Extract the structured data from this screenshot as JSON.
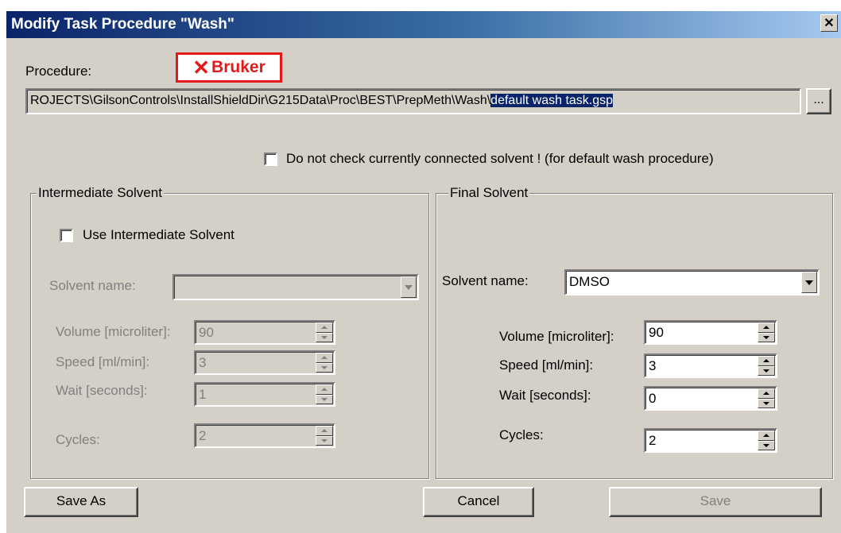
{
  "window": {
    "title": "Modify Task Procedure \"Wash\"",
    "close_label": "✕"
  },
  "logo": {
    "text": "Bruker",
    "mark": "✕"
  },
  "procedure": {
    "label": "Procedure:",
    "path_prefix": "ROJECTS\\GilsonControls\\InstallShieldDir\\G215Data\\Proc\\BEST\\PrepMeth\\Wash\\",
    "path_selected": "default wash task.gsp",
    "browse_label": "..."
  },
  "no_check": {
    "label": "Do not check currently connected solvent ! (for default wash procedure)",
    "checked": false
  },
  "intermediate": {
    "group_title": "Intermediate Solvent",
    "use_label": "Use Intermediate Solvent",
    "use_checked": false,
    "solvent_label": "Solvent name:",
    "solvent_value": "",
    "volume_label": "Volume [microliter]:",
    "volume_value": "90",
    "speed_label": "Speed [ml/min]:",
    "speed_value": "3",
    "wait_label": "Wait [seconds]:",
    "wait_value": "1",
    "cycles_label": "Cycles:",
    "cycles_value": "2"
  },
  "final": {
    "group_title": "Final Solvent",
    "solvent_label": "Solvent name:",
    "solvent_value": "DMSO",
    "volume_label": "Volume [microliter]:",
    "volume_value": "90",
    "speed_label": "Speed [ml/min]:",
    "speed_value": "3",
    "wait_label": "Wait [seconds]:",
    "wait_value": "0",
    "cycles_label": "Cycles:",
    "cycles_value": "2"
  },
  "buttons": {
    "save_as": "Save As",
    "cancel": "Cancel",
    "save": "Save"
  }
}
